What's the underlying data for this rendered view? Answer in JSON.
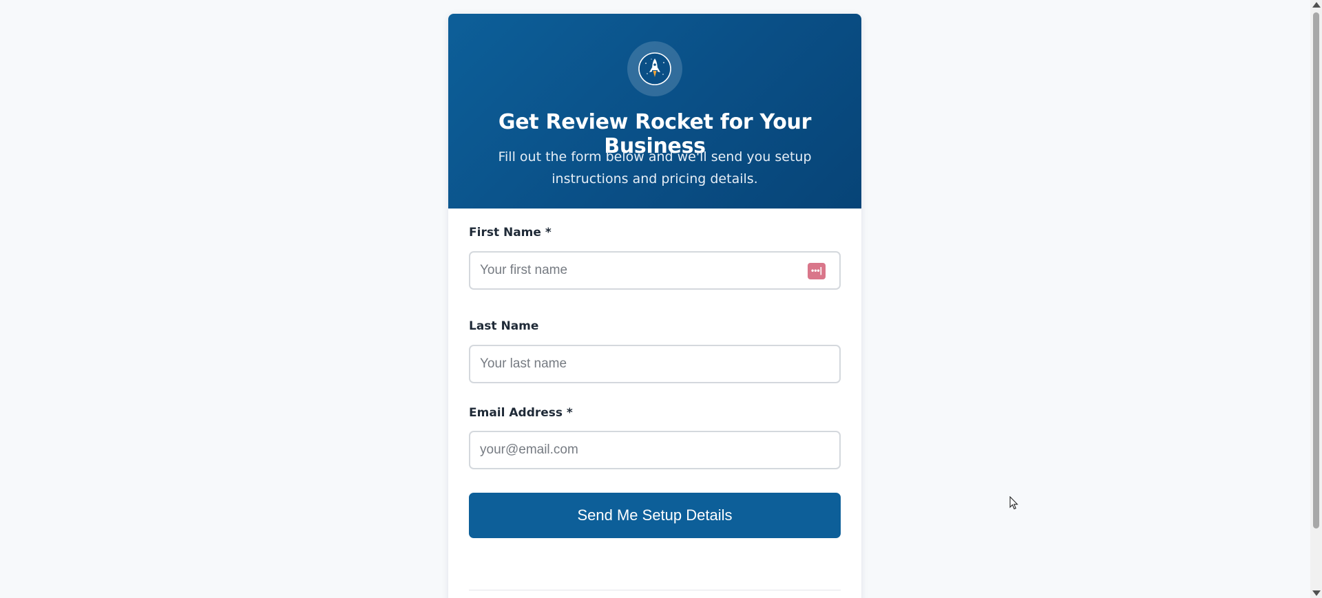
{
  "header": {
    "logo_icon": "rocket-icon",
    "title": "Get Review Rocket for Your Business",
    "subtitle": "Fill out the form below and we'll send you setup instructions and pricing details."
  },
  "form": {
    "first_name": {
      "label": "First Name *",
      "placeholder": "Your first name",
      "value": "",
      "autofill_icon": "password-manager-icon",
      "autofill_glyph": "•••|"
    },
    "last_name": {
      "label": "Last Name",
      "placeholder": "Your last name",
      "value": ""
    },
    "email": {
      "label": "Email Address *",
      "placeholder": "your@email.com",
      "value": ""
    },
    "submit_label": "Send Me Setup Details"
  },
  "colors": {
    "header_gradient_start": "#0d5f99",
    "header_gradient_end": "#074477",
    "button": "#0d5f99",
    "page_background": "#f7f9fb",
    "autofill_icon": "#d9768a"
  }
}
